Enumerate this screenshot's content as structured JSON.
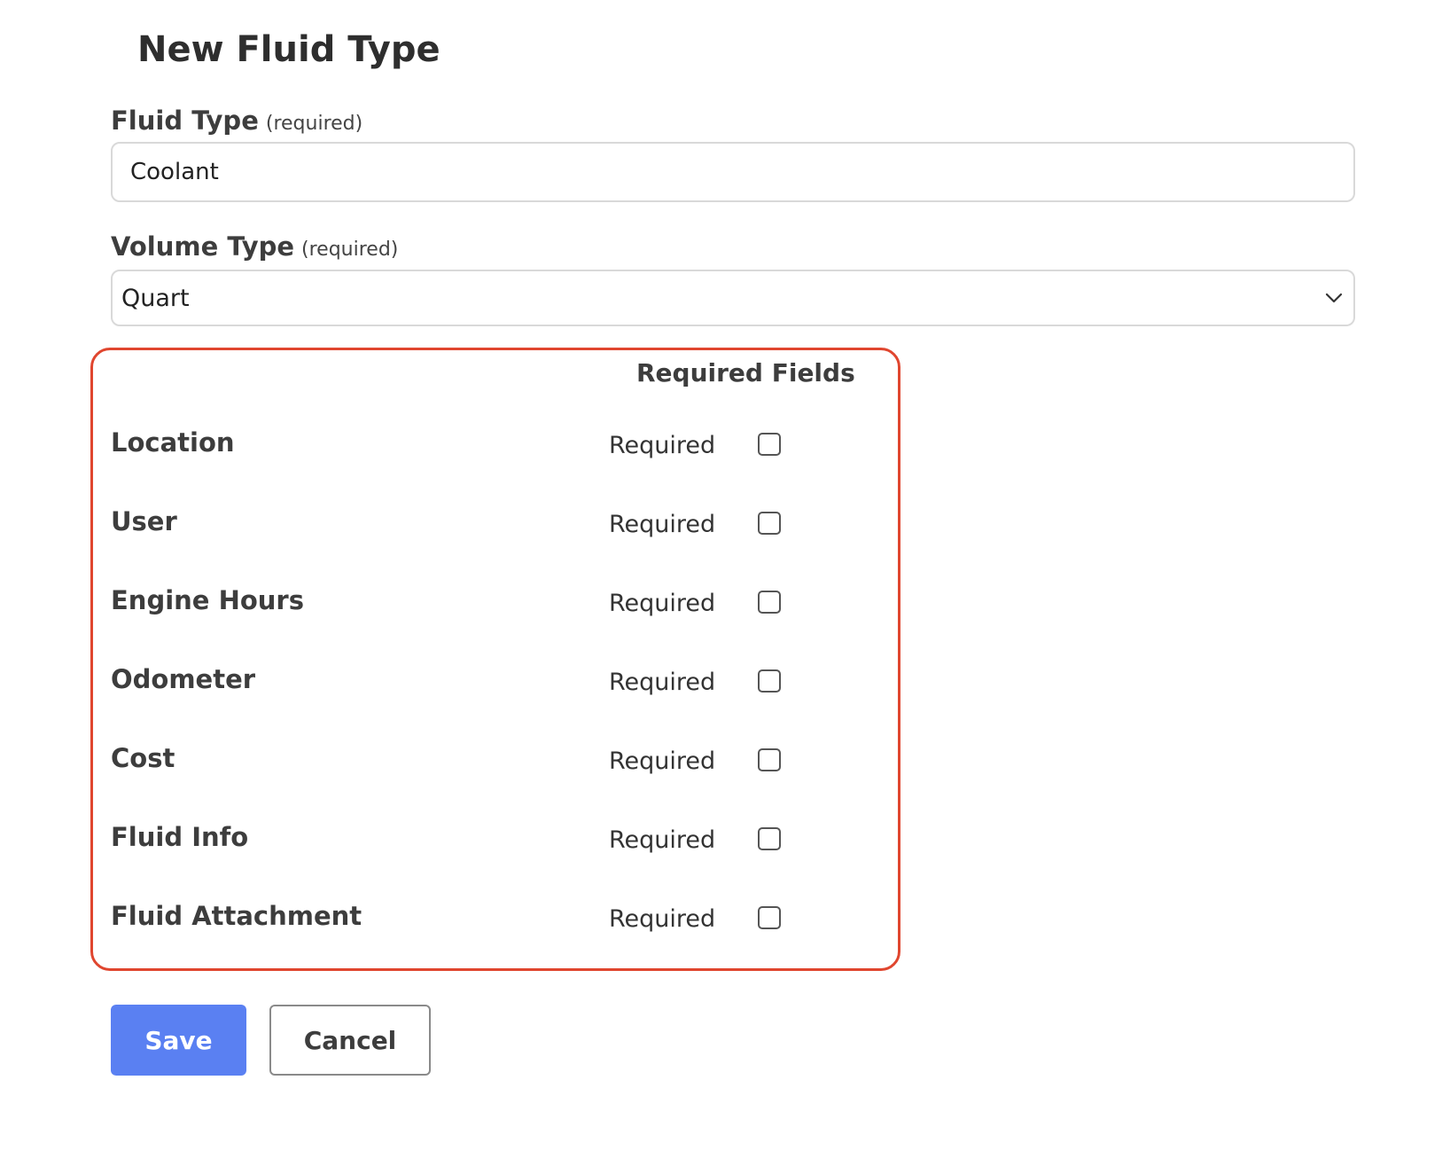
{
  "page": {
    "title": "New Fluid Type"
  },
  "fluid_type": {
    "label": "Fluid Type",
    "required_note": "(required)",
    "value": "Coolant"
  },
  "volume_type": {
    "label": "Volume Type",
    "required_note": "(required)",
    "selected": "Quart"
  },
  "required_fields": {
    "heading": "Required Fields",
    "rows": [
      {
        "name": "Location",
        "toggle_label": "Required",
        "checked": false
      },
      {
        "name": "User",
        "toggle_label": "Required",
        "checked": false
      },
      {
        "name": "Engine Hours",
        "toggle_label": "Required",
        "checked": false
      },
      {
        "name": "Odometer",
        "toggle_label": "Required",
        "checked": false
      },
      {
        "name": "Cost",
        "toggle_label": "Required",
        "checked": false
      },
      {
        "name": "Fluid Info",
        "toggle_label": "Required",
        "checked": false
      },
      {
        "name": "Fluid Attachment",
        "toggle_label": "Required",
        "checked": false
      }
    ]
  },
  "actions": {
    "save_label": "Save",
    "cancel_label": "Cancel"
  },
  "colors": {
    "accent": "#5a80f2",
    "panel_border": "#e0462f"
  }
}
